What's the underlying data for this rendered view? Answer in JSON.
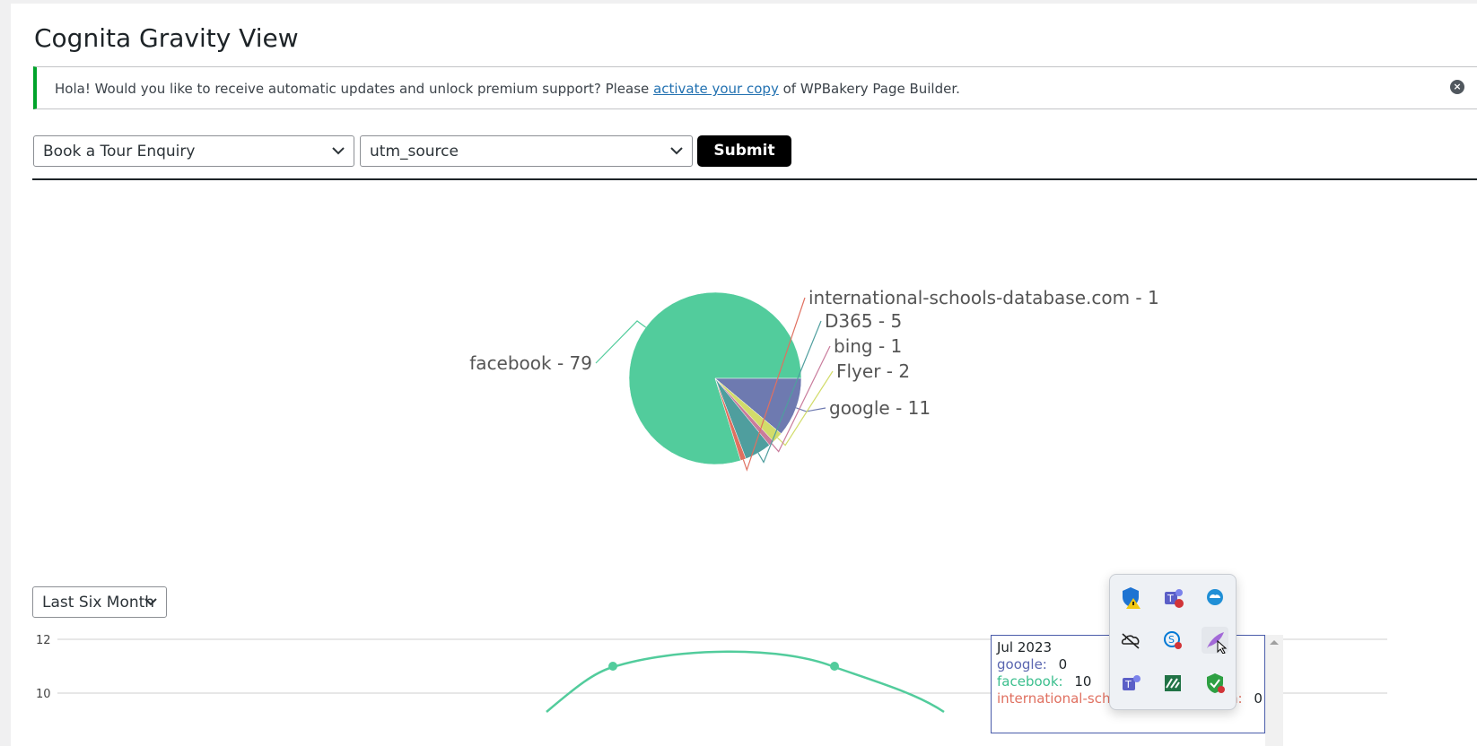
{
  "page": {
    "title": "Cognita Gravity View",
    "notice": {
      "prefix": "Hola! Would you like to receive automatic updates and unlock premium support? Please",
      "link": "activate your copy",
      "suffix": "of WPBakery Page Builder.",
      "dismiss": "×"
    }
  },
  "filters": {
    "form_select": "Book a Tour Enquiry",
    "field_select": "utm_source",
    "submit_label": "Submit",
    "range_select": "Last Six Month"
  },
  "chart_data": [
    {
      "type": "pie",
      "title": "",
      "slices": [
        {
          "label": "facebook",
          "value": 79,
          "color": "#52cc9c"
        },
        {
          "label": "google",
          "value": 11,
          "color": "#6e7ab0"
        },
        {
          "label": "Flyer",
          "value": 2,
          "color": "#d2dc6a"
        },
        {
          "label": "bing",
          "value": 1,
          "color": "#c97c9c"
        },
        {
          "label": "D365",
          "value": 5,
          "color": "#4f9e9e"
        },
        {
          "label": "international-schools-database.com",
          "value": 1,
          "color": "#e07060"
        }
      ],
      "slice_labels": [
        "international-schools-database.com - 1",
        "D365 - 5",
        "bing - 1",
        "Flyer - 2",
        "google - 11",
        "facebook - 79"
      ]
    },
    {
      "type": "line",
      "y_ticks": [
        "12",
        "10"
      ],
      "ylim": [
        10,
        12
      ],
      "series": [
        {
          "label": "facebook",
          "color": "#52cc9c",
          "points": [
            11.0,
            11.0
          ]
        }
      ]
    }
  ],
  "tooltip": {
    "title": "Jul 2023",
    "rows": [
      {
        "label": "google:",
        "value": "0",
        "color": "#5a66b0"
      },
      {
        "label": "facebook:",
        "value": "10",
        "color": "#3cbf8e"
      },
      {
        "label": "international-schools-database.com:",
        "value": "0",
        "color": "#e07060"
      }
    ]
  },
  "tray_icons": [
    "defender-warning-icon",
    "teams-icon",
    "onedrive-blue-icon",
    "onedrive-offline-icon",
    "skype-icon",
    "feather-icon",
    "teams-work-icon",
    "sheets-icon",
    "security-check-icon"
  ]
}
